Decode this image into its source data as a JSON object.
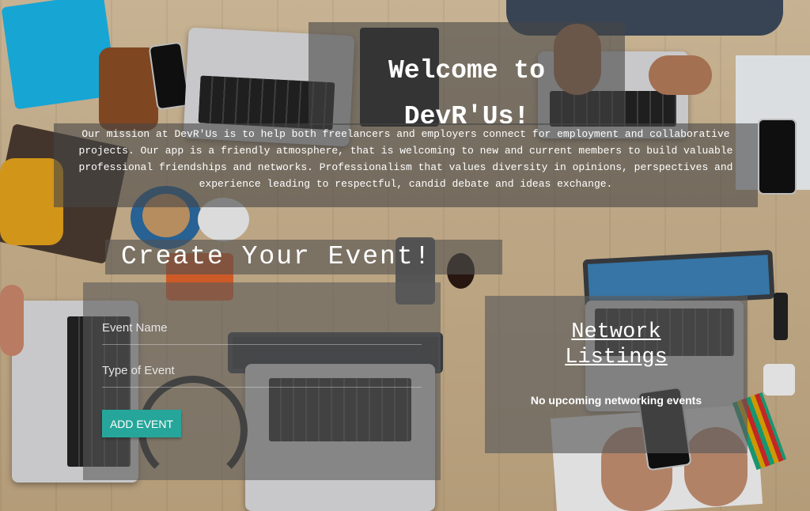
{
  "hero": {
    "title_line1": "Welcome to",
    "title_line2": "DevR'Us!"
  },
  "mission": {
    "text": "Our mission at DevR'Us is to help both freelancers and employers connect for employment and collaborative projects. Our app is a friendly atmosphere, that is welcoming to new and current members to build valuable professional friendships and networks. Professionalism that values diversity in opinions, perspectives and experience leading to respectful, candid debate and ideas exchange."
  },
  "create_event": {
    "heading": "Create Your Event!",
    "event_name_placeholder": "Event Name",
    "event_type_placeholder": "Type of Event",
    "add_button_label": "ADD EVENT"
  },
  "network_listings": {
    "heading_line1": "Network",
    "heading_line2": "Listings",
    "empty_message": "No upcoming networking events"
  },
  "colors": {
    "accent": "#26a69a",
    "panel_overlay": "rgba(70,70,70,0.6)",
    "text": "#ffffff"
  },
  "icons": []
}
